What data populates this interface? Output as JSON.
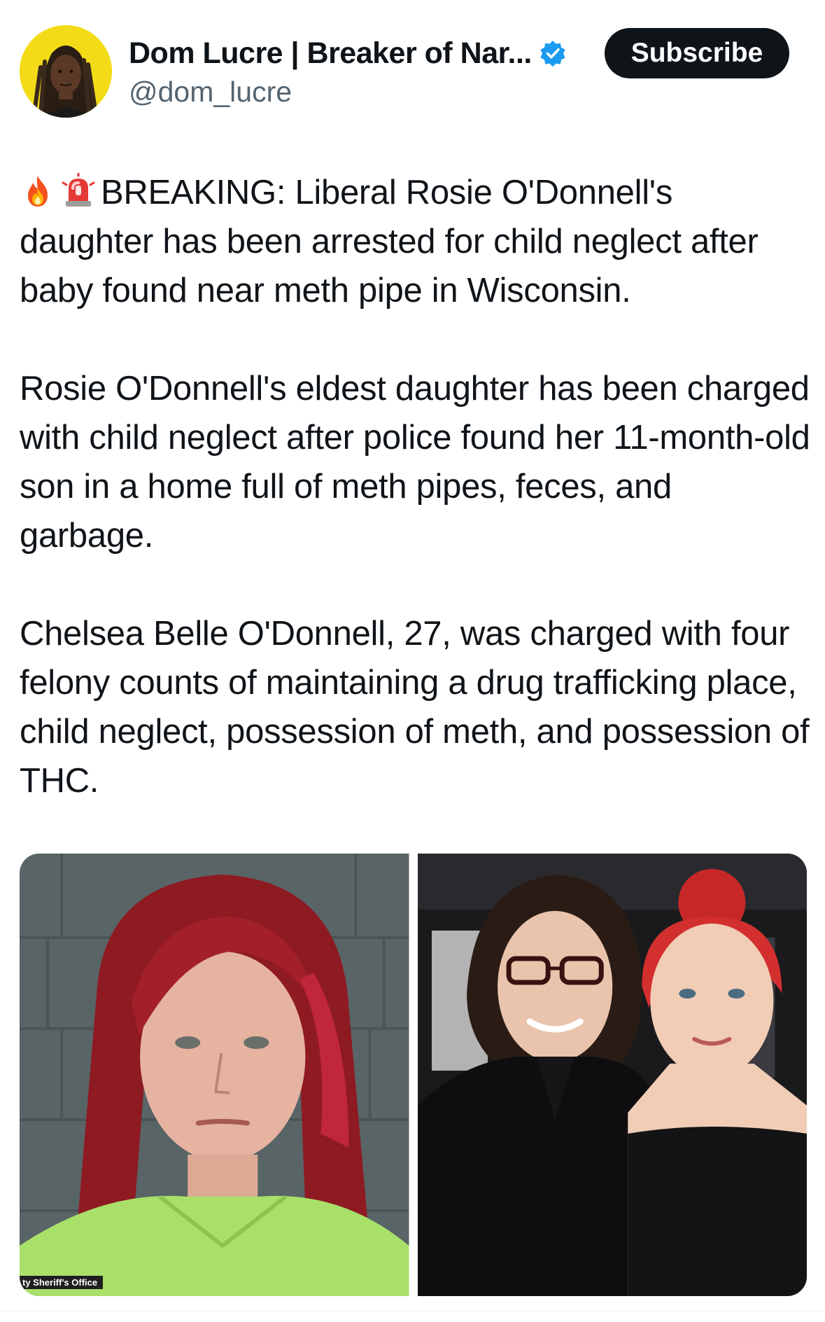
{
  "author": {
    "display_name": "Dom Lucre | Breaker of Nar...",
    "handle": "@dom_lucre",
    "verified": true,
    "verified_color": "#1d9bf0"
  },
  "subscribe_label": "Subscribe",
  "tweet": {
    "emojis": [
      "fire",
      "police-light"
    ],
    "paragraphs": [
      "BREAKING: Liberal Rosie O'Donnell's daughter has been arrested for child neglect after baby found near meth pipe in Wisconsin.",
      "Rosie O'Donnell's eldest daughter has been charged with child neglect after police found her 11-month-old son in a home full of meth pipes, feces, and garbage.",
      "Chelsea Belle O'Donnell, 27, was charged with four felony counts of maintaining a drug trafficking place, child neglect, possession of meth, and possession of THC."
    ]
  },
  "media": {
    "photo1_credit": "ty Sheriff's Office"
  },
  "colors": {
    "text": "#0f1419",
    "secondary": "#536471",
    "button_bg": "#0f1419"
  }
}
